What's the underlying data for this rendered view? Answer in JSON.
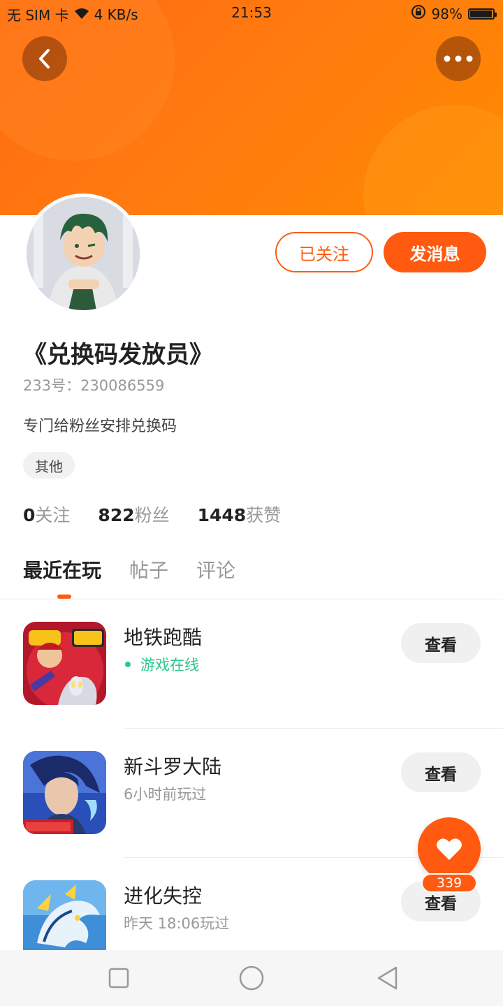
{
  "status_bar": {
    "carrier": "无 SIM 卡",
    "speed": "4 KB/s",
    "time": "21:53",
    "battery": "98%",
    "battery_level": 0.98
  },
  "profile": {
    "name": "《兑换码发放员》",
    "uid": "233号：230086559",
    "bio": "专门给粉丝安排兑换码",
    "tag": "其他",
    "follow_label": "已关注",
    "message_label": "发消息"
  },
  "stats": [
    {
      "value": "0",
      "label": "关注"
    },
    {
      "value": "822",
      "label": "粉丝"
    },
    {
      "value": "1448",
      "label": "获赞"
    }
  ],
  "tabs": [
    "最近在玩",
    "帖子",
    "评论"
  ],
  "games": [
    {
      "name": "地铁跑酷",
      "status": "游戏在线",
      "online": true,
      "button": "查看"
    },
    {
      "name": "新斗罗大陆",
      "status": "6小时前玩过",
      "online": false,
      "button": "查看"
    },
    {
      "name": "进化失控",
      "status": "昨天 18:06玩过",
      "online": false,
      "button": "查看"
    }
  ],
  "like_count": "339",
  "colors": {
    "accent": "#ff5a10",
    "header": "#ff7a10",
    "online": "#2cc788"
  }
}
